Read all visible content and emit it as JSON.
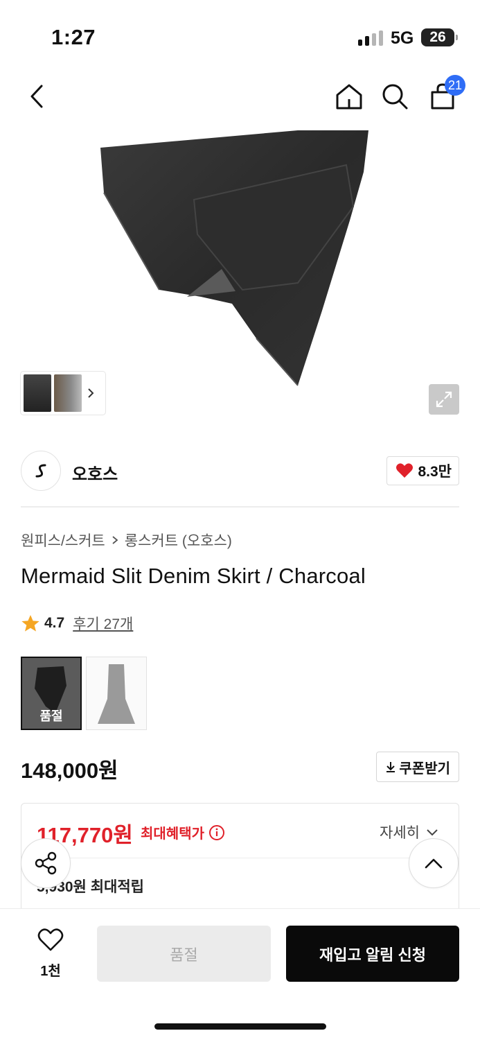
{
  "status_bar": {
    "time": "1:27",
    "network": "5G",
    "battery": "26"
  },
  "nav": {
    "cart_count": "21"
  },
  "brand": {
    "name": "오호스",
    "likes": "8.3만"
  },
  "breadcrumb": {
    "category": "원피스/스커트",
    "subcategory": "롱스커트 (오호스)"
  },
  "product": {
    "title": "Mermaid Slit Denim Skirt / Charcoal",
    "rating": "4.7",
    "reviews": "후기 27개",
    "options": [
      {
        "label": "품절",
        "color": "#222222",
        "selected": true
      },
      {
        "label": "",
        "color": "#9a9a9a",
        "selected": false
      }
    ]
  },
  "price": {
    "regular": "148,000원",
    "coupon_button": "쿠폰받기"
  },
  "benefit": {
    "max_benefit_price": "117,770원",
    "max_benefit_label": "최대혜택가",
    "details_label": "자세히",
    "points_text": "5,930원 최대적립",
    "accent_color": "#e0212a"
  },
  "bottom": {
    "wish_count": "1천",
    "soldout_label": "품절",
    "restock_label": "재입고 알림 신청"
  }
}
